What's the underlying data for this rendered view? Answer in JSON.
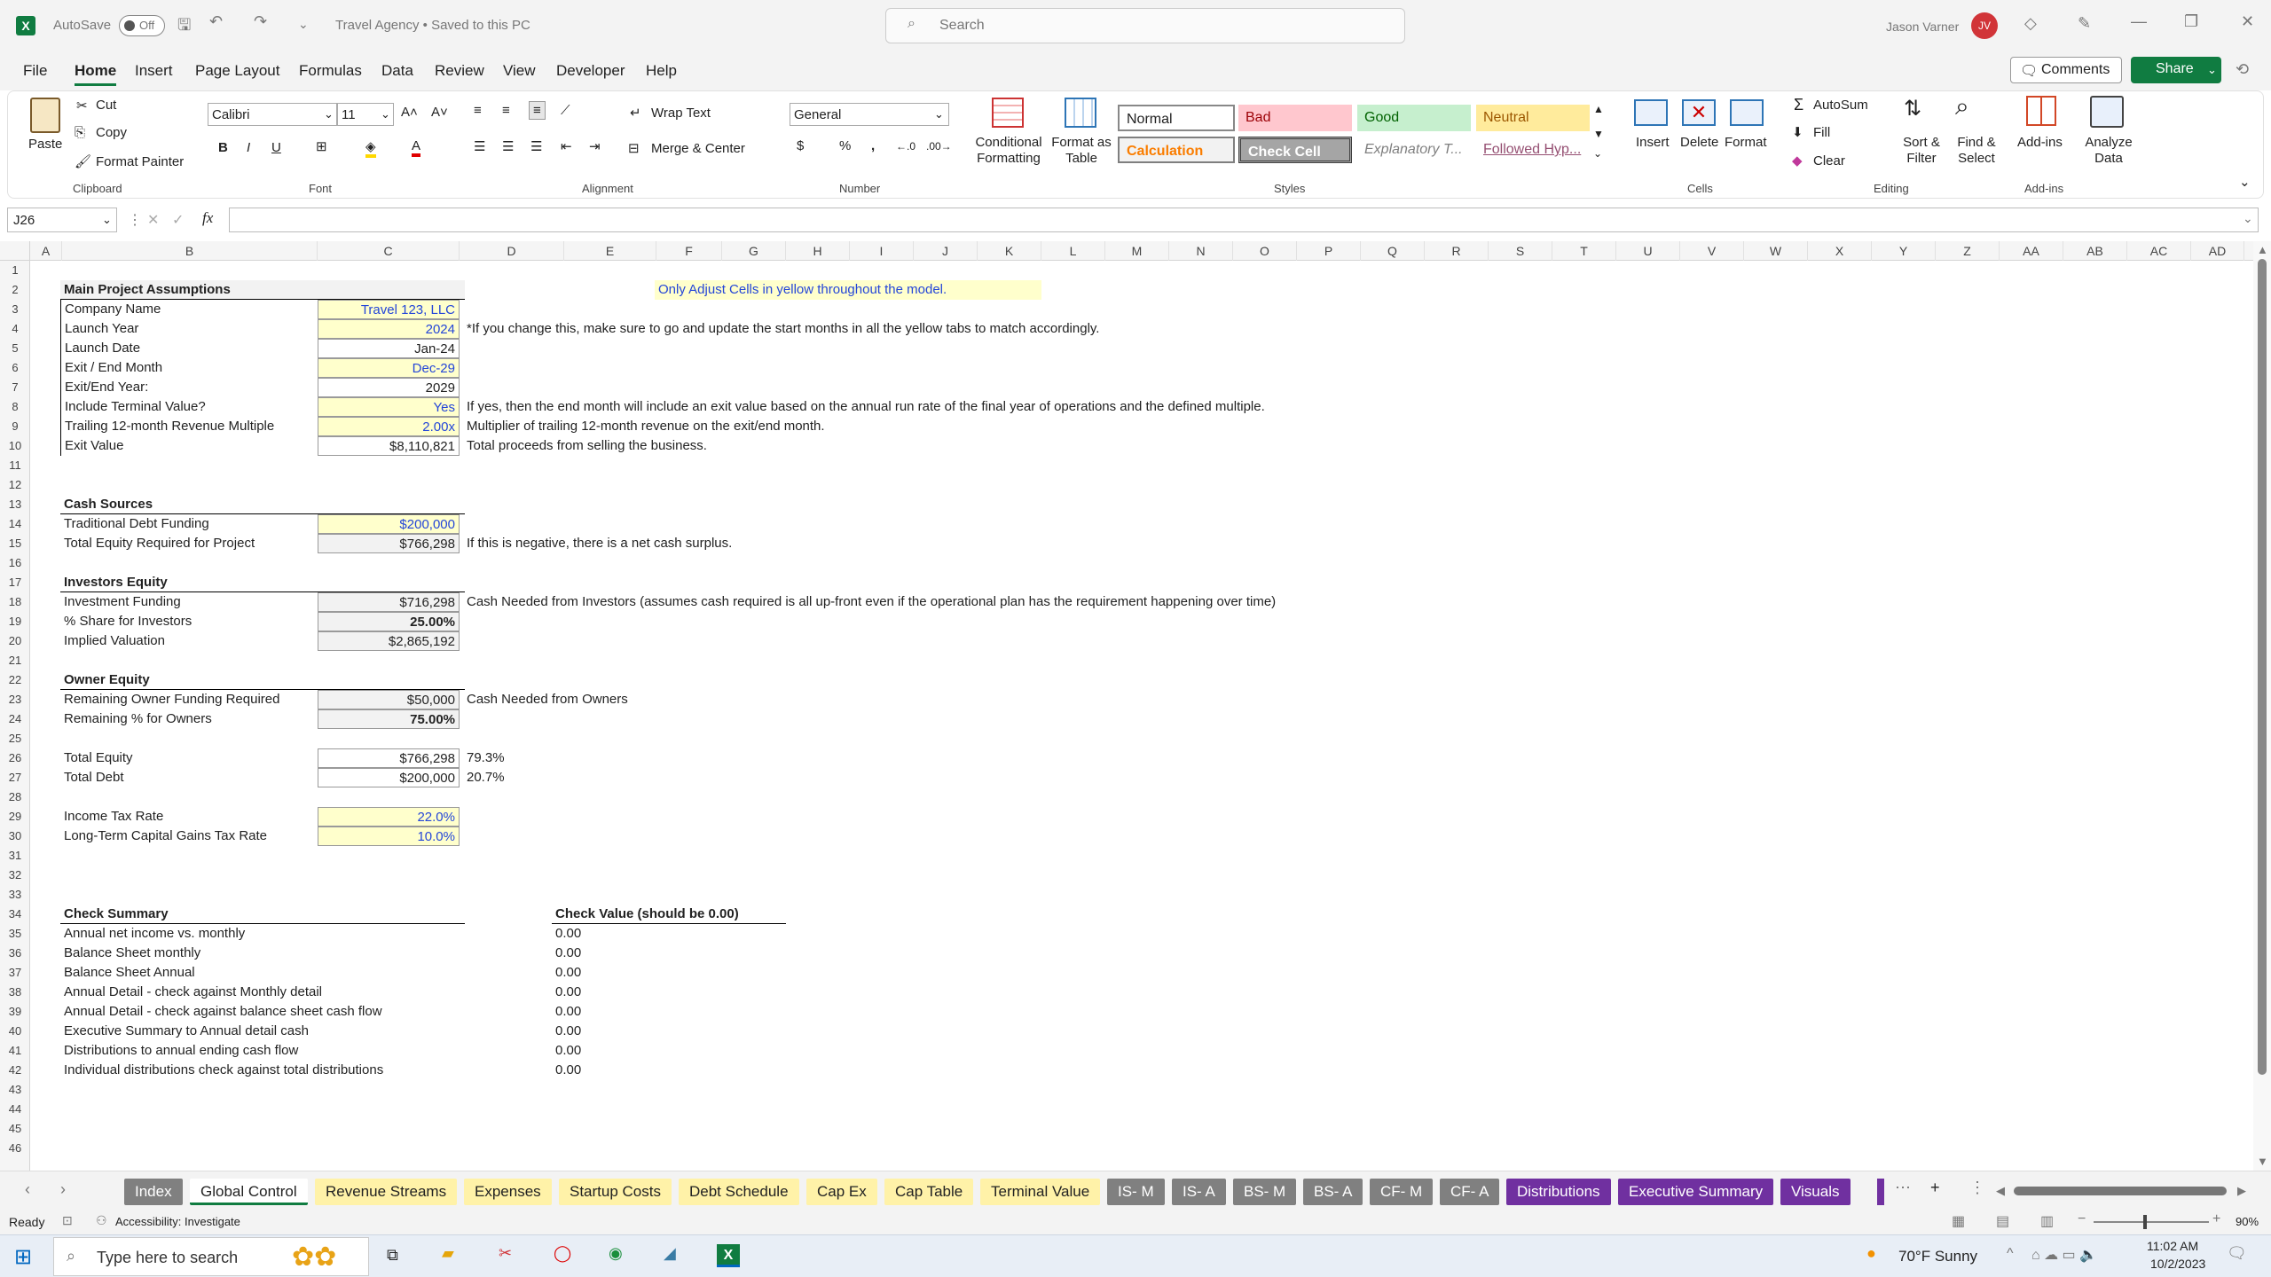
{
  "titlebar": {
    "autosave": "AutoSave",
    "toggle": "Off",
    "filename": "Travel Agency • Saved to this PC",
    "search_placeholder": "Search",
    "user": "Jason Varner",
    "initials": "JV"
  },
  "menu": [
    "File",
    "Home",
    "Insert",
    "Page Layout",
    "Formulas",
    "Data",
    "Review",
    "View",
    "Developer",
    "Help"
  ],
  "menu_right": {
    "comments": "Comments",
    "share": "Share"
  },
  "ribbon": {
    "paste": "Paste",
    "cut": "Cut",
    "copy": "Copy",
    "format_painter": "Format Painter",
    "clipboard": "Clipboard",
    "font_name": "Calibri",
    "font_size": "11",
    "font": "Font",
    "wrap_text": "Wrap Text",
    "merge_center": "Merge & Center",
    "alignment": "Alignment",
    "number_format": "General",
    "number": "Number",
    "conditional_formatting": "Conditional Formatting",
    "format_as_table": "Format as Table",
    "styles": {
      "normal": "Normal",
      "bad": "Bad",
      "good": "Good",
      "neutral": "Neutral",
      "calculation": "Calculation",
      "check_cell": "Check Cell",
      "explanatory": "Explanatory T...",
      "followed": "Followed Hyp..."
    },
    "styles_label": "Styles",
    "insert": "Insert",
    "delete": "Delete",
    "format": "Format",
    "cells": "Cells",
    "autosum": "AutoSum",
    "fill": "Fill",
    "clear": "Clear",
    "sort_filter": "Sort & Filter",
    "find_select": "Find & Select",
    "editing": "Editing",
    "addins": "Add-ins",
    "addins_label": "Add-ins",
    "analyze": "Analyze Data"
  },
  "namebox": "J26",
  "fx": "fx",
  "columns": [
    "A",
    "B",
    "C",
    "D",
    "E",
    "F",
    "G",
    "H",
    "I",
    "J",
    "K",
    "L",
    "M",
    "N",
    "O",
    "P",
    "Q",
    "R",
    "S",
    "T",
    "U",
    "V",
    "W",
    "X",
    "Y",
    "Z",
    "AA",
    "AB",
    "AC",
    "AD"
  ],
  "rows": [
    "1",
    "2",
    "3",
    "4",
    "5",
    "6",
    "7",
    "8",
    "9",
    "10",
    "11",
    "12",
    "13",
    "14",
    "15",
    "16",
    "17",
    "18",
    "19",
    "20",
    "21",
    "22",
    "23",
    "24",
    "25",
    "26",
    "27",
    "28",
    "29",
    "30",
    "31",
    "32",
    "33",
    "34",
    "35",
    "36",
    "37",
    "38",
    "39",
    "40",
    "41",
    "42",
    "43",
    "44",
    "45",
    "46"
  ],
  "sheet": {
    "main_header": "Main Project Assumptions",
    "note_yellow": "Only Adjust Cells in yellow throughout the model.",
    "assumptions": [
      {
        "label": "Company Name",
        "value": "Travel 123, LLC",
        "note": ""
      },
      {
        "label": "Launch Year",
        "value": "2024",
        "note": "*If you change this, make sure to go and update the start months in all the yellow tabs to match accordingly."
      },
      {
        "label": "Launch Date",
        "value": "Jan-24",
        "note": ""
      },
      {
        "label": "Exit / End Month",
        "value": "Dec-29",
        "note": ""
      },
      {
        "label": "Exit/End Year:",
        "value": "2029",
        "note": ""
      },
      {
        "label": "Include Terminal Value?",
        "value": "Yes",
        "note": "If yes, then the end month will include an exit value based on the annual run rate of the final year of operations and the defined multiple."
      },
      {
        "label": "Trailing 12-month Revenue Multiple",
        "value": "2.00x",
        "note": "Multiplier of trailing 12-month revenue on the exit/end month."
      },
      {
        "label": "Exit Value",
        "value": "$8,110,821",
        "note": "Total proceeds from selling the business."
      }
    ],
    "cash_header": "Cash Sources",
    "cash": [
      {
        "label": "Traditional Debt Funding",
        "value": "$200,000",
        "note": ""
      },
      {
        "label": "Total Equity Required for Project",
        "value": "$766,298",
        "note": "If this is negative, there is a net cash surplus."
      }
    ],
    "inv_header": "Investors Equity",
    "investors": [
      {
        "label": "Investment Funding",
        "value": "$716,298",
        "note": "Cash Needed from Investors (assumes cash required is all up-front even if the operational plan has the requirement happening over time)"
      },
      {
        "label": "% Share for Investors",
        "value": "25.00%",
        "note": ""
      },
      {
        "label": "Implied Valuation",
        "value": "$2,865,192",
        "note": ""
      }
    ],
    "own_header": "Owner Equity",
    "owners": [
      {
        "label": "Remaining Owner Funding Required",
        "value": "$50,000",
        "note": "Cash Needed from Owners"
      },
      {
        "label": "Remaining % for Owners",
        "value": "75.00%",
        "note": ""
      }
    ],
    "totals": [
      {
        "label": "Total Equity",
        "value": "$766,298",
        "note": "79.3%"
      },
      {
        "label": "Total Debt",
        "value": "$200,000",
        "note": "20.7%"
      }
    ],
    "tax": [
      {
        "label": "Income Tax Rate",
        "value": "22.0%"
      },
      {
        "label": "Long-Term Capital Gains Tax Rate",
        "value": "10.0%"
      }
    ],
    "check_header": "Check Summary",
    "check_value_header": "Check Value (should be 0.00)",
    "checks": [
      {
        "label": "Annual net income vs. monthly",
        "value": "0.00"
      },
      {
        "label": "Balance Sheet monthly",
        "value": "0.00"
      },
      {
        "label": "Balance Sheet Annual",
        "value": "0.00"
      },
      {
        "label": "Annual Detail - check against Monthly detail",
        "value": "0.00"
      },
      {
        "label": "Annual Detail - check against balance sheet cash flow",
        "value": "0.00"
      },
      {
        "label": "Executive Summary to Annual detail cash",
        "value": "0.00"
      },
      {
        "label": "Distributions to annual ending cash flow",
        "value": "0.00"
      },
      {
        "label": "Individual distributions check against total distributions",
        "value": "0.00"
      }
    ]
  },
  "tabs": [
    {
      "name": "Index",
      "style": "gray"
    },
    {
      "name": "Global Control",
      "style": "active"
    },
    {
      "name": "Revenue Streams",
      "style": "yellow"
    },
    {
      "name": "Expenses",
      "style": "yellow"
    },
    {
      "name": "Startup Costs",
      "style": "yellow"
    },
    {
      "name": "Debt Schedule",
      "style": "yellow"
    },
    {
      "name": "Cap Ex",
      "style": "yellow"
    },
    {
      "name": "Cap Table",
      "style": "yellow"
    },
    {
      "name": "Terminal Value",
      "style": "yellow"
    },
    {
      "name": "IS- M",
      "style": "gray"
    },
    {
      "name": "IS- A",
      "style": "gray"
    },
    {
      "name": "BS- M",
      "style": "gray"
    },
    {
      "name": "BS- A",
      "style": "gray"
    },
    {
      "name": "CF- M",
      "style": "gray"
    },
    {
      "name": "CF- A",
      "style": "gray"
    },
    {
      "name": "Distributions",
      "style": "purple"
    },
    {
      "name": "Executive Summary",
      "style": "purple"
    },
    {
      "name": "Visuals",
      "style": "purple"
    }
  ],
  "status": {
    "ready": "Ready",
    "accessibility": "Accessibility: Investigate",
    "zoom": "90%"
  },
  "taskbar": {
    "search_placeholder": "Type here to search",
    "weather": "70°F  Sunny",
    "time": "11:02 AM",
    "date": "10/2/2023"
  },
  "colors": {
    "excel_green": "#107c41",
    "share_green": "#107c41",
    "input_yellow": "#ffffcc",
    "tab_purple": "#7030a0",
    "tab_gray": "#808080",
    "tab_yellow": "#fff2a8"
  }
}
